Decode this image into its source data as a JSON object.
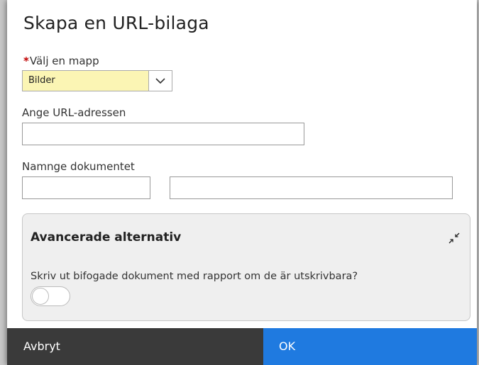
{
  "dialog": {
    "title": "Skapa en URL-bilaga",
    "folder": {
      "required_marker": "*",
      "label": "Välj en mapp",
      "selected": "Bilder"
    },
    "url": {
      "label": "Ange URL-adressen",
      "value": ""
    },
    "document_name": {
      "label": "Namnge dokumentet",
      "first_value": "",
      "second_value": ""
    },
    "advanced": {
      "title": "Avancerade alternativ",
      "print_question": "Skriv ut bifogade dokument med rapport om de är utskrivbara?",
      "print_enabled": false
    },
    "footer": {
      "cancel_label": "Avbryt",
      "ok_label": "OK"
    }
  },
  "icons": {
    "dropdown": "chevron-down-icon",
    "collapse": "collapse-arrows-icon"
  },
  "colors": {
    "select_highlight": "#fbf5b4",
    "cancel_bg": "#3a3a3a",
    "ok_bg": "#1f7ae0",
    "required": "#c00000"
  }
}
